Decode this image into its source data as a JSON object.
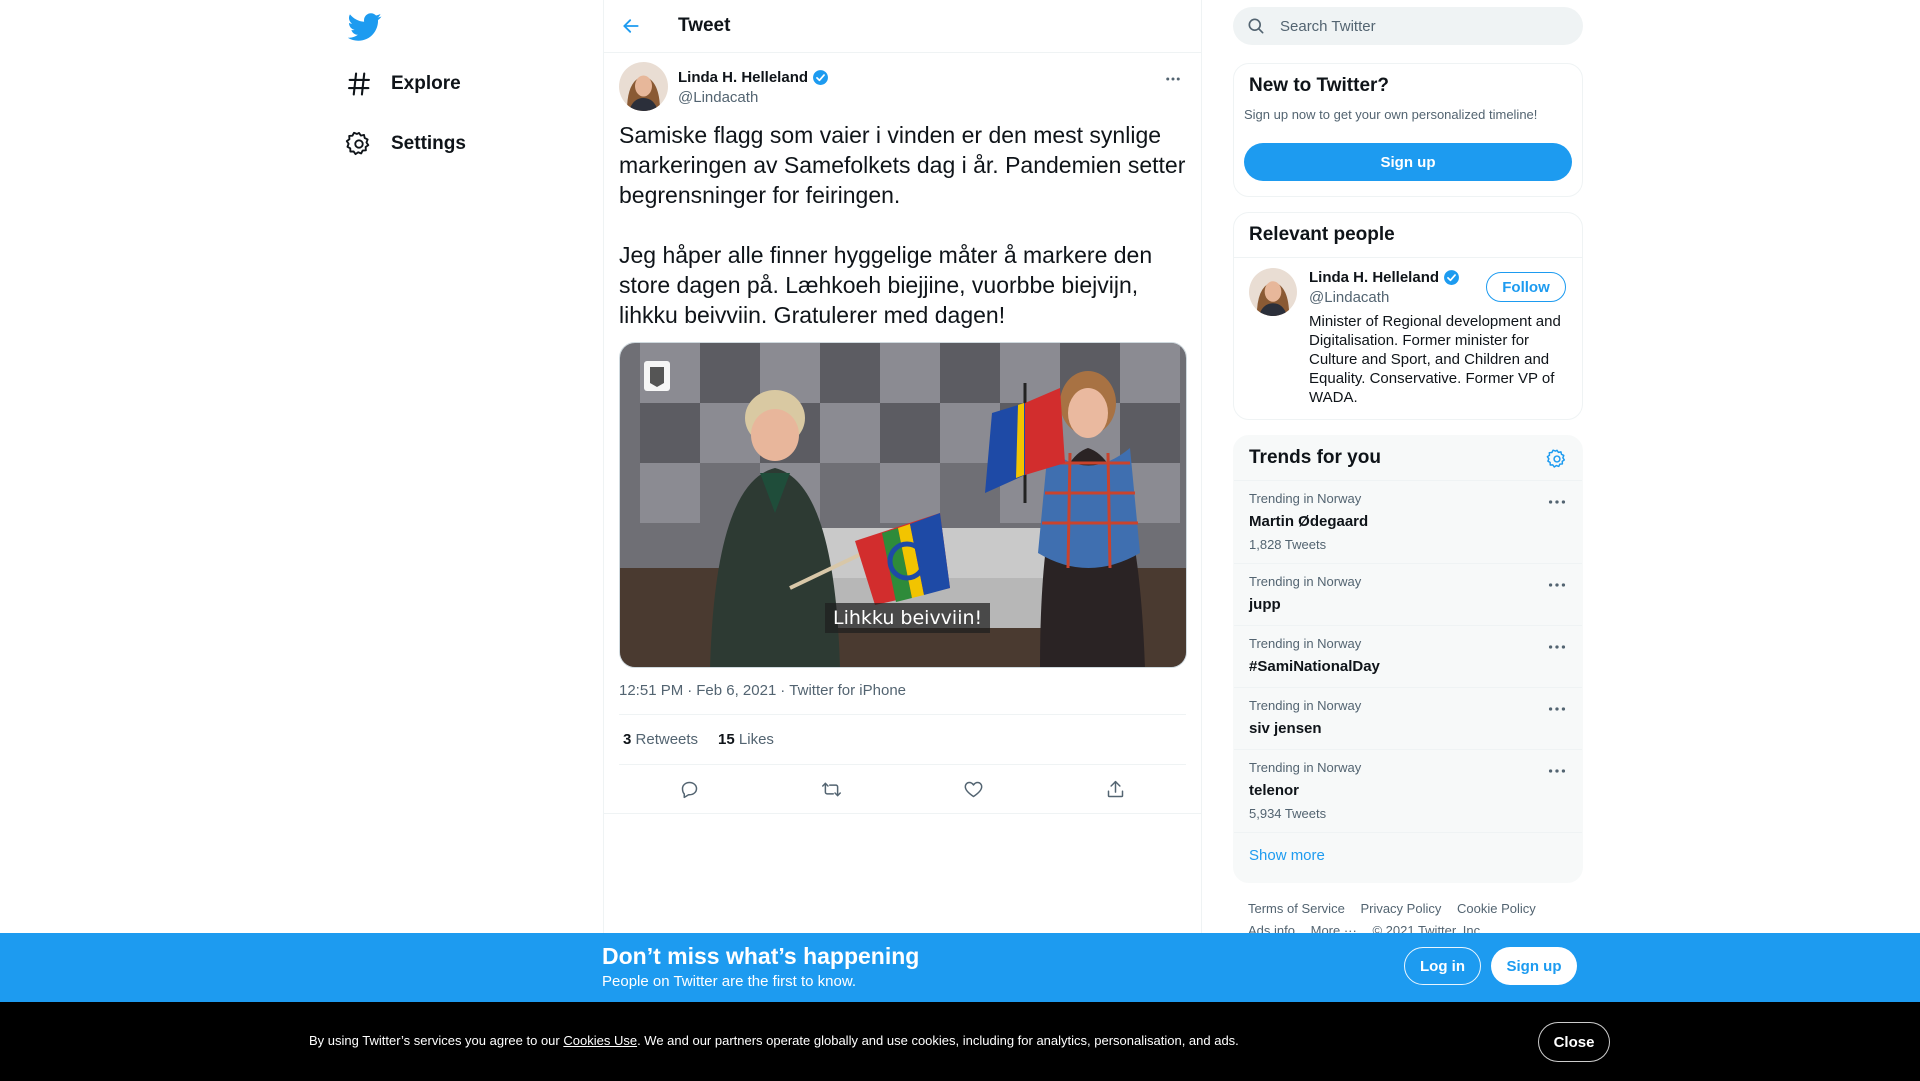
{
  "nav": {
    "logo_icon": "twitter-bird-icon",
    "items": [
      {
        "label": "Explore",
        "icon": "hashtag-icon"
      },
      {
        "label": "Settings",
        "icon": "gear-icon"
      }
    ]
  },
  "header": {
    "title": "Tweet",
    "back_icon": "arrow-left-icon"
  },
  "tweet": {
    "author_name": "Linda H. Helleland",
    "author_handle": "@Lindacath",
    "verified": true,
    "paragraphs": [
      "Samiske flagg som vaier i vinden er den mest synlige markeringen av Samefolkets dag i år. Pandemien setter begrensninger for feiringen.",
      "Jeg håper alle finner hyggelige måter å markere den store dagen på. Læhkoeh biejjine, vuorbbe biejvijn, lihkku beivviin. Gratulerer med dagen!"
    ],
    "media_caption": "Lihkku beivviin!",
    "time": "12:51 PM",
    "date": "Feb 6, 2021",
    "separator": "·",
    "source": "Twitter for iPhone",
    "retweets_count": "3",
    "retweets_label": "Retweets",
    "likes_count": "15",
    "likes_label": "Likes",
    "action_icons": [
      "reply-icon",
      "retweet-icon",
      "like-icon",
      "share-icon"
    ]
  },
  "search": {
    "placeholder": "Search Twitter"
  },
  "new_to_twitter": {
    "title": "New to Twitter?",
    "subtitle": "Sign up now to get your own personalized timeline!",
    "button": "Sign up"
  },
  "relevant_people": {
    "title": "Relevant people",
    "person": {
      "name": "Linda H. Helleland",
      "handle": "@Lindacath",
      "follow_label": "Follow",
      "bio": "Minister of Regional development and Digitalisation. Former minister for Culture and Sport, and Children and Equality. Conservative. Former VP of WADA."
    }
  },
  "trends": {
    "title": "Trends for you",
    "items": [
      {
        "context": "Trending in Norway",
        "topic": "Martin Ødegaard",
        "count": "1,828 Tweets"
      },
      {
        "context": "Trending in Norway",
        "topic": "jupp",
        "count": ""
      },
      {
        "context": "Trending in Norway",
        "topic": "#SamiNationalDay",
        "count": ""
      },
      {
        "context": "Trending in Norway",
        "topic": "siv jensen",
        "count": ""
      },
      {
        "context": "Trending in Norway",
        "topic": "telenor",
        "count": "5,934 Tweets"
      }
    ],
    "show_more": "Show more"
  },
  "footer": {
    "links": [
      "Terms of Service",
      "Privacy Policy",
      "Cookie Policy",
      "Ads info",
      "More ···",
      "© 2021 Twitter, Inc."
    ]
  },
  "banner": {
    "title": "Don’t miss what’s happening",
    "subtitle": "People on Twitter are the first to know.",
    "login": "Log in",
    "signup": "Sign up"
  },
  "cookie": {
    "prefix": "By using Twitter’s services you agree to our ",
    "link": "Cookies Use",
    "suffix": ". We and our partners operate globally and use cookies, including for analytics, personalisation, and ads.",
    "close": "Close"
  },
  "colors": {
    "accent": "#1d9bf0",
    "text": "#0f1419",
    "secondary": "#536471",
    "cookie_bg": "#000000"
  }
}
